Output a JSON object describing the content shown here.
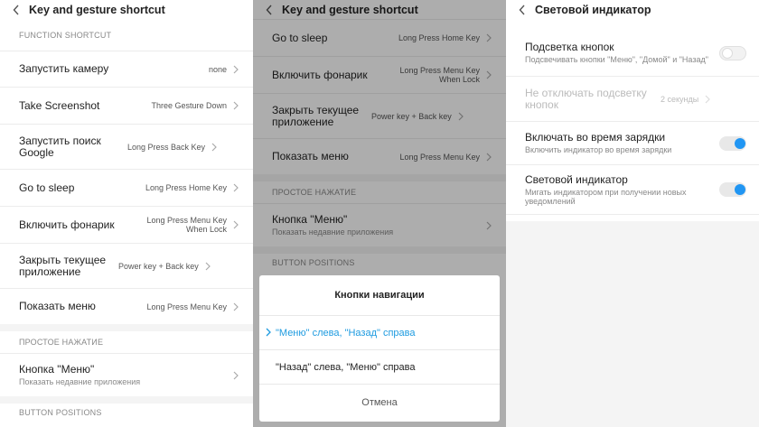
{
  "panel1": {
    "title": "Key and gesture shortcut",
    "section_function": "FUNCTION SHORTCUT",
    "rows": [
      {
        "label": "Запустить камеру",
        "value": "none"
      },
      {
        "label": "Take Screenshot",
        "value": "Three Gesture Down"
      },
      {
        "label": "Запустить поиск Google",
        "value": "Long Press Back Key"
      },
      {
        "label": "Go to sleep",
        "value": "Long Press Home Key"
      },
      {
        "label": "Включить фонарик",
        "value": "Long Press Menu Key When Lock"
      },
      {
        "label": "Закрыть текущее приложение",
        "value": "Power key + Back key"
      },
      {
        "label": "Показать меню",
        "value": "Long Press Menu Key"
      }
    ],
    "section_simple": "ПРОСТОЕ НАЖАТИЕ",
    "menu_row": {
      "label": "Кнопка \"Меню\"",
      "sub": "Показать недавние приложения"
    },
    "section_positions": "BUTTON POSITIONS"
  },
  "panel2": {
    "title": "Key and gesture shortcut",
    "rows": [
      {
        "label": "Go to sleep",
        "value": "Long Press Home Key"
      },
      {
        "label": "Включить фонарик",
        "value": "Long Press Menu Key When Lock"
      },
      {
        "label": "Закрыть текущее приложение",
        "value": "Power key + Back key"
      },
      {
        "label": "Показать меню",
        "value": "Long Press Menu Key"
      }
    ],
    "section_simple": "ПРОСТОЕ НАЖАТИЕ",
    "menu_row": {
      "label": "Кнопка \"Меню\"",
      "sub": "Показать недавние приложения"
    },
    "section_positions": "BUTTON POSITIONS",
    "dialog": {
      "title": "Кнопки навигации",
      "option1": "\"Меню\" слева, \"Назад\" справа",
      "option2": "\"Назад\" слева, \"Меню\" справа",
      "cancel": "Отмена"
    }
  },
  "panel3": {
    "title": "Световой индикатор",
    "rows": [
      {
        "label": "Подсветка кнопок",
        "sub": "Подсвечивать кнопки \"Меню\", \"Домой\" и \"Назад\""
      },
      {
        "label": "Не отключать подсветку кнопок",
        "value": "2 секунды"
      },
      {
        "label": "Включать во время зарядки",
        "sub": "Включить индикатор во время зарядки"
      },
      {
        "label": "Световой индикатор",
        "sub": "Мигать индикатором при получении новых уведомлений"
      }
    ]
  },
  "colors": {
    "accent": "#2196f3",
    "selected_text": "#1e9be0"
  },
  "icons": {
    "back": "chevron-left-icon",
    "chevron": "chevron-right-icon",
    "check": "chevron-right-icon"
  }
}
